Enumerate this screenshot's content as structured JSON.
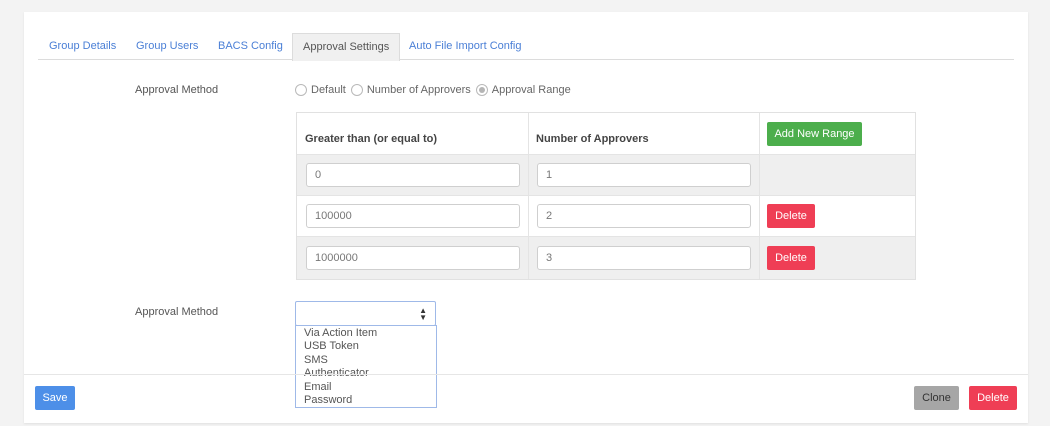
{
  "tabs": [
    {
      "label": "Group Details"
    },
    {
      "label": "Group Users"
    },
    {
      "label": "BACS Config"
    },
    {
      "label": "Approval Settings"
    },
    {
      "label": "Auto File Import Config"
    }
  ],
  "active_tab": "Approval Settings",
  "approval_method": {
    "label": "Approval Method",
    "options": [
      "Default",
      "Number of Approvers",
      "Approval Range"
    ],
    "selected": "Approval Range"
  },
  "range_table": {
    "headers": {
      "greater_than": "Greater than (or equal to)",
      "num_approvers": "Number of Approvers"
    },
    "add_button": "Add New Range",
    "rows": [
      {
        "greater_than": "0",
        "num_approvers": "1",
        "delete": ""
      },
      {
        "greater_than": "100000",
        "num_approvers": "2",
        "delete": "Delete"
      },
      {
        "greater_than": "1000000",
        "num_approvers": "3",
        "delete": "Delete"
      }
    ]
  },
  "approval_method_select": {
    "label": "Approval Method",
    "value": "",
    "options": [
      "Via Action Item",
      "USB Token",
      "SMS",
      "Authenticator",
      "Email",
      "Password"
    ]
  },
  "footer": {
    "save": "Save",
    "clone": "Clone",
    "delete": "Delete"
  },
  "colors": {
    "link": "#4a7fd6",
    "green": "#4cae4c",
    "red": "#ef3e55",
    "blue": "#4d8fe8",
    "gray": "#a6a6a6"
  }
}
